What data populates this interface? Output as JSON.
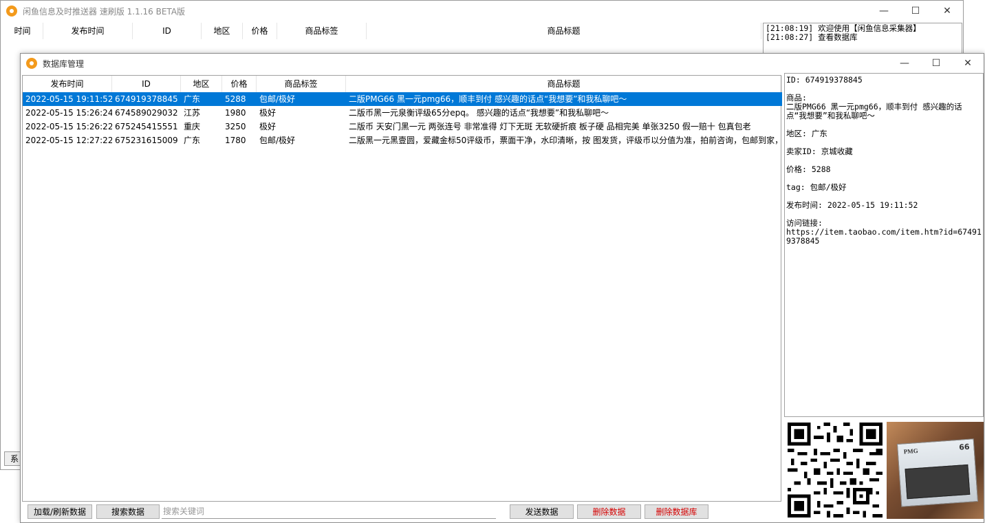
{
  "main_window": {
    "title": "闲鱼信息及时推送器 速刷版 1.1.16 BETA版",
    "columns": [
      "时间",
      "发布时间",
      "ID",
      "地区",
      "价格",
      "商品标签",
      "商品标题"
    ],
    "log": [
      "[21:08:19] 欢迎使用【闲鱼信息采集器】",
      "[21:08:27] 查看数据库"
    ],
    "status_label": "系统"
  },
  "db_window": {
    "title": "数据库管理",
    "columns": [
      "发布时间",
      "ID",
      "地区",
      "价格",
      "商品标签",
      "商品标题"
    ],
    "rows": [
      {
        "time": "2022-05-15 19:11:52",
        "id": "674919378845",
        "region": "广东",
        "price": "5288",
        "tag": "包邮/极好",
        "title": "二版PMG66 黑一元pmg66，顺丰到付 感兴趣的话点“我想要”和我私聊吧～"
      },
      {
        "time": "2022-05-15 15:26:24",
        "id": "674589029032",
        "region": "江苏",
        "price": "1980",
        "tag": "极好",
        "title": "二版币黑一元泉衡评级65分epq。 感兴趣的话点“我想要”和我私聊吧～"
      },
      {
        "time": "2022-05-15 15:26:22",
        "id": "675245415551",
        "region": "重庆",
        "price": "3250",
        "tag": "极好",
        "title": "二版币 天安门黑一元  两张连号  非常准得  灯下无斑 无软硬折痕   板子硬 品相完美  单张3250   假一赔十  包真包老"
      },
      {
        "time": "2022-05-15 12:27:22",
        "id": "675231615009",
        "region": "广东",
        "price": "1780",
        "tag": "包邮/极好",
        "title": "二版黑一元黑壹圆，爱藏金标50评级币，票面干净，水印清晰，按 图发货，评级币以分值为准，拍前咨询，包邮到家，"
      }
    ],
    "detail": {
      "id_line": "ID: 674919378845",
      "product_label": "商品:",
      "product_value": "二版PMG66 黑一元pmg66，顺丰到付 感兴趣的话点“我想要”和我私聊吧～",
      "region_line": "地区: 广东",
      "seller_line": "卖家ID: 京城收藏",
      "price_line": "价格: 5288",
      "tag_line": "tag: 包邮/极好",
      "time_line": "发布时间: 2022-05-15 19:11:52",
      "link_label": "访问链接:",
      "link_value": "https://item.taobao.com/item.htm?id=674919378845"
    },
    "photo": {
      "brand": "PMG",
      "grade": "66"
    },
    "buttons": {
      "load": "加载/刷新数据",
      "search": "搜索数据",
      "send": "发送数据",
      "delete": "删除数据",
      "delete_db": "删除数据库"
    },
    "search_placeholder": "搜索关键词",
    "colors": {
      "selection": "#0078d7",
      "danger": "#d40000",
      "accent": "#f39a1c"
    }
  }
}
